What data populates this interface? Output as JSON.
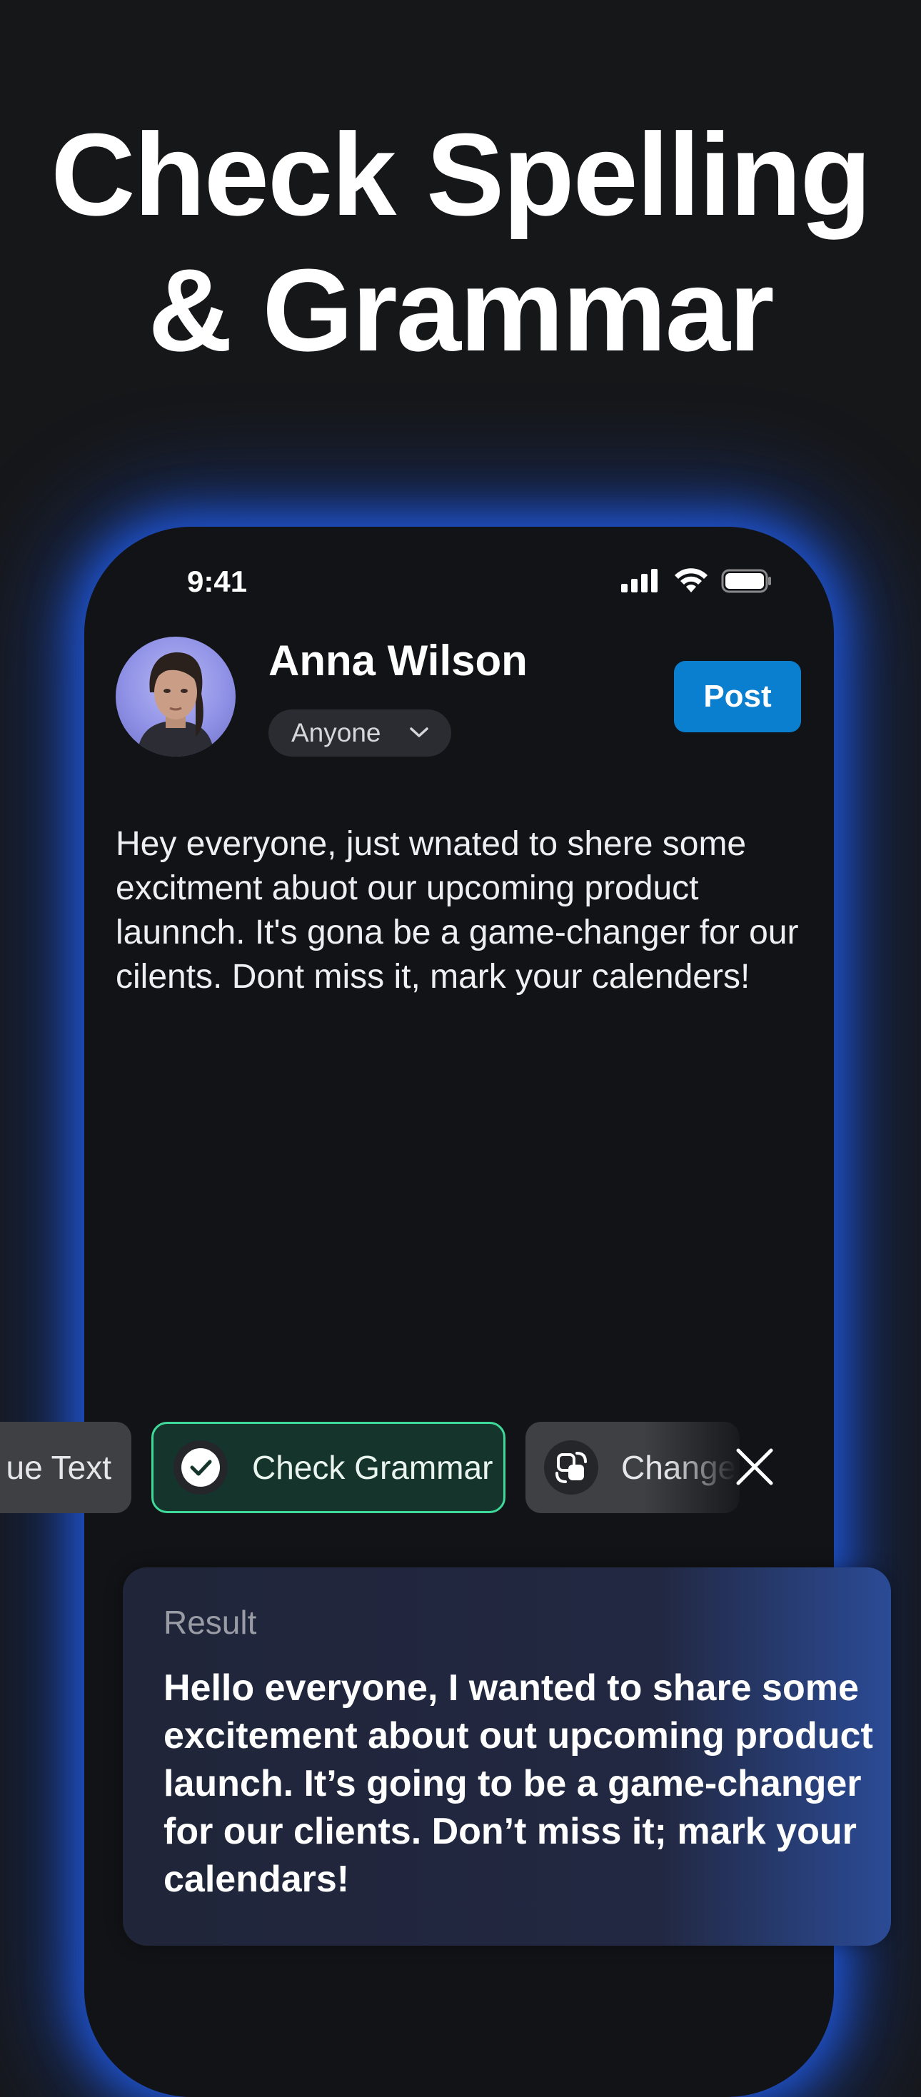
{
  "headline": {
    "line1": "Check Spelling",
    "line2": "& Grammar"
  },
  "status_bar": {
    "time": "9:41",
    "icons": [
      "cellular-signal-icon",
      "wifi-icon",
      "battery-icon"
    ]
  },
  "composer": {
    "user_name": "Anna Wilson",
    "audience": "Anyone",
    "post_label": "Post",
    "draft_text": "Hey everyone, just wnated to shere some excitment abuot our upcoming product launnch. It's gona be a game-changer for our cilents. Dont miss it, mark your calenders!"
  },
  "actions": {
    "chips": [
      {
        "label": "Continue Text",
        "visible_label": "ue Text"
      },
      {
        "label": "Check Grammar",
        "icon": "check-circle-icon",
        "selected": true
      },
      {
        "label": "Change",
        "icon": "convert-icon"
      }
    ],
    "close_icon": "close-icon"
  },
  "result": {
    "label": "Result",
    "text": "Hello everyone, I wanted to share some excitement about out upcoming product launch. It’s going to be a game-changer for our clients. Don’t miss it; mark your calendars!"
  },
  "colors": {
    "background": "#161719",
    "phone_surface": "#121316",
    "phone_glow": "#215ce6",
    "post_button": "#0a7fd0",
    "selected_chip_border": "#3fd99a",
    "selected_chip_fill": "#15342c"
  }
}
